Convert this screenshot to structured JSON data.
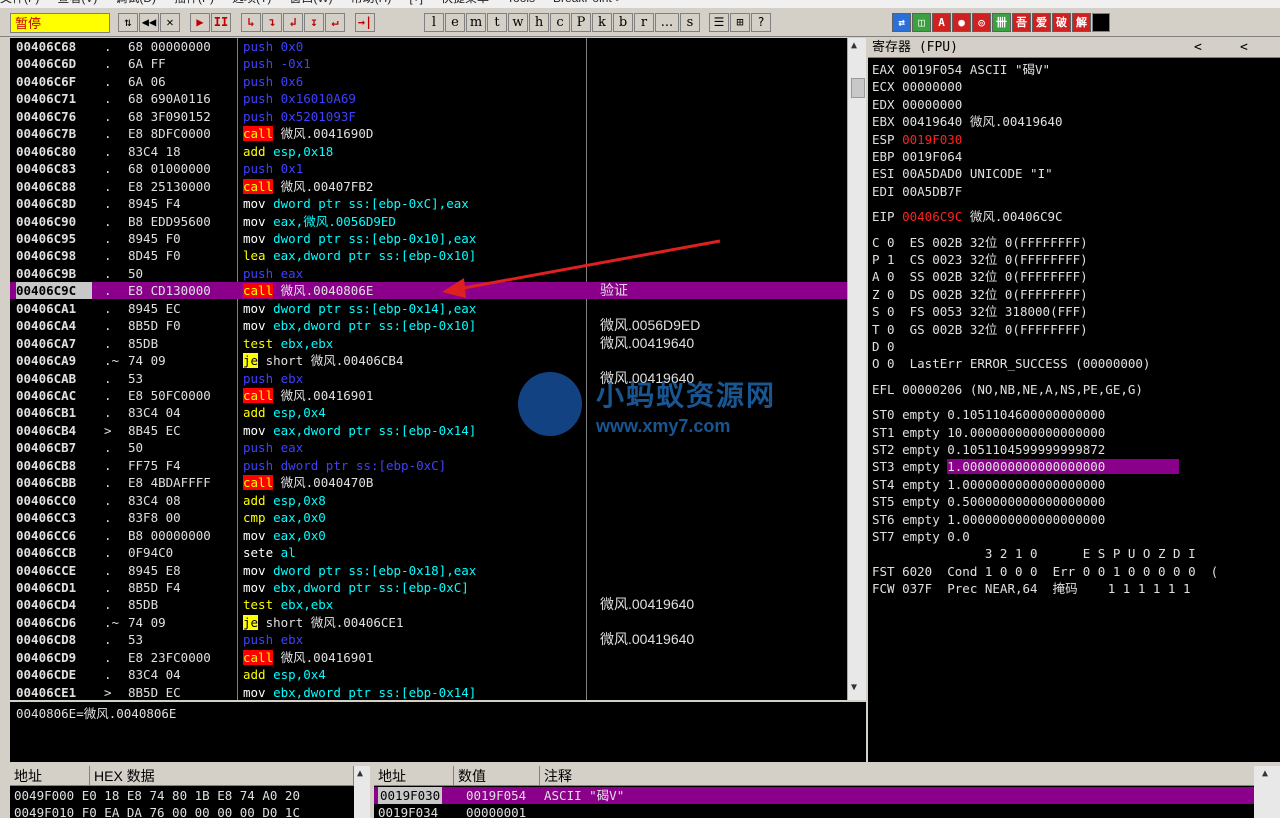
{
  "menu": [
    "文件(F)",
    "查看(V)",
    "调试(D)",
    "插件(P)",
    "选项(T)",
    "窗口(W)",
    "帮助(H)",
    "[+]",
    "快捷菜单",
    "Tools",
    "BreakPoint->"
  ],
  "toolbar": {
    "status": "暂停",
    "buttons": [
      "⇅",
      "◀◀",
      "✕",
      "▶",
      "II",
      "↳",
      "↴",
      "↲",
      "↧",
      "↵",
      "→|"
    ],
    "letters": [
      "l",
      "e",
      "m",
      "t",
      "w",
      "h",
      "c",
      "P",
      "k",
      "b",
      "r",
      "...",
      "s"
    ],
    "extra": [
      "☰",
      "⊞",
      "?"
    ],
    "plugins": [
      "⇄",
      "◫",
      "A",
      "●",
      "◎",
      "卌",
      "吾",
      "爱",
      "破",
      "解"
    ]
  },
  "cpu_rows": [
    {
      "addr": "00406C68",
      "mk": ".",
      "hex": "68 00000000",
      "op": "push",
      "args": "0x0",
      "cmt": ""
    },
    {
      "addr": "00406C6D",
      "mk": ".",
      "hex": "6A FF",
      "op": "push",
      "args": "-0x1",
      "cmt": ""
    },
    {
      "addr": "00406C6F",
      "mk": ".",
      "hex": "6A 06",
      "op": "push",
      "args": "0x6",
      "cmt": ""
    },
    {
      "addr": "00406C71",
      "mk": ".",
      "hex": "68 690A0116",
      "op": "push",
      "args": "0x16010A69",
      "cmt": ""
    },
    {
      "addr": "00406C76",
      "mk": ".",
      "hex": "68 3F090152",
      "op": "push",
      "args": "0x5201093F",
      "cmt": ""
    },
    {
      "addr": "00406C7B",
      "mk": ".",
      "hex": "E8 8DFC0000",
      "op": "call",
      "args": "微风.0041690D",
      "cmt": ""
    },
    {
      "addr": "00406C80",
      "mk": ".",
      "hex": "83C4 18",
      "op": "add",
      "args": "esp,0x18",
      "cmt": ""
    },
    {
      "addr": "00406C83",
      "mk": ".",
      "hex": "68 01000000",
      "op": "push",
      "args": "0x1",
      "cmt": ""
    },
    {
      "addr": "00406C88",
      "mk": ".",
      "hex": "E8 25130000",
      "op": "call",
      "args": "微风.00407FB2",
      "cmt": ""
    },
    {
      "addr": "00406C8D",
      "mk": ".",
      "hex": "8945 F4",
      "op": "mov",
      "args": "dword ptr ss:[ebp-0xC],eax",
      "cmt": ""
    },
    {
      "addr": "00406C90",
      "mk": ".",
      "hex": "B8 EDD95600",
      "op": "mov",
      "args": "eax,微风.0056D9ED",
      "cmt": ""
    },
    {
      "addr": "00406C95",
      "mk": ".",
      "hex": "8945 F0",
      "op": "mov",
      "args": "dword ptr ss:[ebp-0x10],eax",
      "cmt": ""
    },
    {
      "addr": "00406C98",
      "mk": ".",
      "hex": "8D45 F0",
      "op": "lea",
      "args": "eax,dword ptr ss:[ebp-0x10]",
      "cmt": ""
    },
    {
      "addr": "00406C9B",
      "mk": ".",
      "hex": "50",
      "op": "push",
      "args": "eax",
      "cmt": ""
    },
    {
      "addr": "00406C9C",
      "mk": ".",
      "hex": "E8 CD130000",
      "op": "call",
      "args": "微风.0040806E",
      "cmt": "验证",
      "sel": true
    },
    {
      "addr": "00406CA1",
      "mk": ".",
      "hex": "8945 EC",
      "op": "mov",
      "args": "dword ptr ss:[ebp-0x14],eax",
      "cmt": ""
    },
    {
      "addr": "00406CA4",
      "mk": ".",
      "hex": "8B5D F0",
      "op": "mov",
      "args": "ebx,dword ptr ss:[ebp-0x10]",
      "cmt": "微风.0056D9ED"
    },
    {
      "addr": "00406CA7",
      "mk": ".",
      "hex": "85DB",
      "op": "test",
      "args": "ebx,ebx",
      "cmt": "微风.00419640"
    },
    {
      "addr": "00406CA9",
      "mk": ".~",
      "hex": "74 09",
      "op": "je",
      "args": "short 微风.00406CB4",
      "cmt": ""
    },
    {
      "addr": "00406CAB",
      "mk": ".",
      "hex": "53",
      "op": "push",
      "args": "ebx",
      "cmt": "微风.00419640"
    },
    {
      "addr": "00406CAC",
      "mk": ".",
      "hex": "E8 50FC0000",
      "op": "call",
      "args": "微风.00416901",
      "cmt": ""
    },
    {
      "addr": "00406CB1",
      "mk": ".",
      "hex": "83C4 04",
      "op": "add",
      "args": "esp,0x4",
      "cmt": ""
    },
    {
      "addr": "00406CB4",
      "mk": ">",
      "hex": "8B45 EC",
      "op": "mov",
      "args": "eax,dword ptr ss:[ebp-0x14]",
      "cmt": ""
    },
    {
      "addr": "00406CB7",
      "mk": ".",
      "hex": "50",
      "op": "push",
      "args": "eax",
      "cmt": ""
    },
    {
      "addr": "00406CB8",
      "mk": ".",
      "hex": "FF75 F4",
      "op": "push",
      "args": "dword ptr ss:[ebp-0xC]",
      "cmt": ""
    },
    {
      "addr": "00406CBB",
      "mk": ".",
      "hex": "E8 4BDAFFFF",
      "op": "call",
      "args": "微风.0040470B",
      "cmt": ""
    },
    {
      "addr": "00406CC0",
      "mk": ".",
      "hex": "83C4 08",
      "op": "add",
      "args": "esp,0x8",
      "cmt": ""
    },
    {
      "addr": "00406CC3",
      "mk": ".",
      "hex": "83F8 00",
      "op": "cmp",
      "args": "eax,0x0",
      "cmt": ""
    },
    {
      "addr": "00406CC6",
      "mk": ".",
      "hex": "B8 00000000",
      "op": "mov",
      "args": "eax,0x0",
      "cmt": ""
    },
    {
      "addr": "00406CCB",
      "mk": ".",
      "hex": "0F94C0",
      "op": "sete",
      "args": "al",
      "cmt": ""
    },
    {
      "addr": "00406CCE",
      "mk": ".",
      "hex": "8945 E8",
      "op": "mov",
      "args": "dword ptr ss:[ebp-0x18],eax",
      "cmt": ""
    },
    {
      "addr": "00406CD1",
      "mk": ".",
      "hex": "8B5D F4",
      "op": "mov",
      "args": "ebx,dword ptr ss:[ebp-0xC]",
      "cmt": ""
    },
    {
      "addr": "00406CD4",
      "mk": ".",
      "hex": "85DB",
      "op": "test",
      "args": "ebx,ebx",
      "cmt": "微风.00419640"
    },
    {
      "addr": "00406CD6",
      "mk": ".~",
      "hex": "74 09",
      "op": "je",
      "args": "short 微风.00406CE1",
      "cmt": ""
    },
    {
      "addr": "00406CD8",
      "mk": ".",
      "hex": "53",
      "op": "push",
      "args": "ebx",
      "cmt": "微风.00419640"
    },
    {
      "addr": "00406CD9",
      "mk": ".",
      "hex": "E8 23FC0000",
      "op": "call",
      "args": "微风.00416901",
      "cmt": ""
    },
    {
      "addr": "00406CDE",
      "mk": ".",
      "hex": "83C4 04",
      "op": "add",
      "args": "esp,0x4",
      "cmt": ""
    },
    {
      "addr": "00406CE1",
      "mk": ">",
      "hex": "8B5D EC",
      "op": "mov",
      "args": "ebx,dword ptr ss:[ebp-0x14]",
      "cmt": ""
    }
  ],
  "info_text": "0040806E=微风.0040806E",
  "registers": {
    "title": "寄存器 (FPU)",
    "lines": [
      {
        "t": "EAX 0019F054 ASCII \"碣V\""
      },
      {
        "t": "ECX 00000000"
      },
      {
        "t": "EDX 00000000"
      },
      {
        "t": "EBX 00419640 微风.00419640"
      },
      {
        "t": "ESP ",
        "red": "0019F030"
      },
      {
        "t": "EBP 0019F064"
      },
      {
        "t": "ESI 00A5DAD0 UNICODE \"I\""
      },
      {
        "t": "EDI 00A5DB7F"
      },
      {
        "t": ""
      },
      {
        "t": "EIP ",
        "red": "00406C9C",
        "after": " 微风.00406C9C"
      },
      {
        "t": ""
      },
      {
        "t": "C 0  ES 002B 32位 0(FFFFFFFF)"
      },
      {
        "t": "P 1  CS 0023 32位 0(FFFFFFFF)"
      },
      {
        "t": "A 0  SS 002B 32位 0(FFFFFFFF)"
      },
      {
        "t": "Z 0  DS 002B 32位 0(FFFFFFFF)"
      },
      {
        "t": "S 0  FS 0053 32位 318000(FFF)"
      },
      {
        "t": "T 0  GS 002B 32位 0(FFFFFFFF)"
      },
      {
        "t": "D 0"
      },
      {
        "t": "O 0  LastErr ERROR_SUCCESS (00000000)"
      },
      {
        "t": ""
      },
      {
        "t": "EFL 00000206 (NO,NB,NE,A,NS,PE,GE,G)"
      },
      {
        "t": ""
      },
      {
        "t": "ST0 empty 0.1051104600000000000"
      },
      {
        "t": "ST1 empty 10.000000000000000000"
      },
      {
        "t": "ST2 empty 0.1051104599999999872"
      },
      {
        "t": "ST3 empty ",
        "hl": "1.0000000000000000000"
      },
      {
        "t": "ST4 empty 1.0000000000000000000"
      },
      {
        "t": "ST5 empty 0.5000000000000000000"
      },
      {
        "t": "ST6 empty 1.0000000000000000000"
      },
      {
        "t": "ST7 empty 0.0"
      },
      {
        "t": "               3 2 1 0      E S P U O Z D I"
      },
      {
        "t": "FST 6020  Cond 1 0 0 0  Err 0 0 1 0 0 0 0 0  ("
      },
      {
        "t": "FCW 037F  Prec NEAR,64  掩码    1 1 1 1 1 1"
      }
    ]
  },
  "dump": {
    "headers": [
      "地址",
      "HEX 数据"
    ],
    "rows": [
      "0049F000 E0 18 E8 74 80 1B E8 74 A0 20",
      "0049F010 F0 EA DA 76 00 00 00 00 D0 1C"
    ]
  },
  "stack": {
    "headers": [
      "地址",
      "数值",
      "注释"
    ],
    "rows": [
      {
        "addr": "0019F030",
        "val": "0019F054",
        "cmt": "ASCII \"碣V\"",
        "sel": true
      },
      {
        "addr": "0019F034",
        "val": "00000001",
        "cmt": ""
      }
    ]
  },
  "watermark": {
    "cn": "小蚂蚁资源网",
    "url": "www.xmy7.com"
  }
}
